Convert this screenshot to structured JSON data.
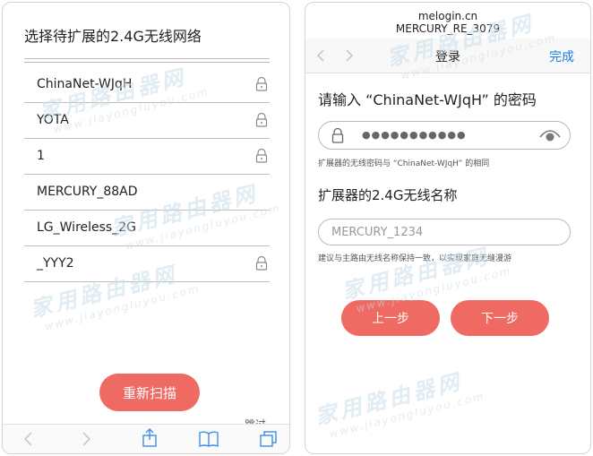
{
  "left": {
    "title": "选择待扩展的2.4G无线网络",
    "networks": [
      {
        "name": "ChinaNet-WJqH",
        "locked": true
      },
      {
        "name": "YOTA",
        "locked": true
      },
      {
        "name": "1",
        "locked": true
      },
      {
        "name": "MERCURY_88AD",
        "locked": false
      },
      {
        "name": "LG_Wireless_2G",
        "locked": false
      },
      {
        "name": "_YYY2",
        "locked": true
      }
    ],
    "rescan_label": "重新扫描",
    "skip_label": "跳过"
  },
  "right": {
    "url_host": "melogin.cn",
    "url_ssid": "MERCURY_RE_3079",
    "nav_title": "登录",
    "done_label": "完成",
    "password_heading": "请输入 “ChinaNet-WJqH” 的密码",
    "password_masked": "●●●●●●●●●●●",
    "password_hint": "扩展器的无线密码与 “ChinaNet-WJqH” 的相同",
    "ssid_heading": "扩展器的2.4G无线名称",
    "ssid_placeholder": "MERCURY_1234",
    "ssid_hint": "建议与主路由无线名称保持一致，以实现家庭无缝漫游",
    "prev_label": "上一步",
    "next_label": "下一步"
  },
  "watermark": {
    "text": "家用路由器网",
    "url": "www.jiayongluyou.com"
  },
  "colors": {
    "accent_button": "#ef6a63",
    "link_blue": "#1a7ee6",
    "watermark": "#c9ddea"
  }
}
